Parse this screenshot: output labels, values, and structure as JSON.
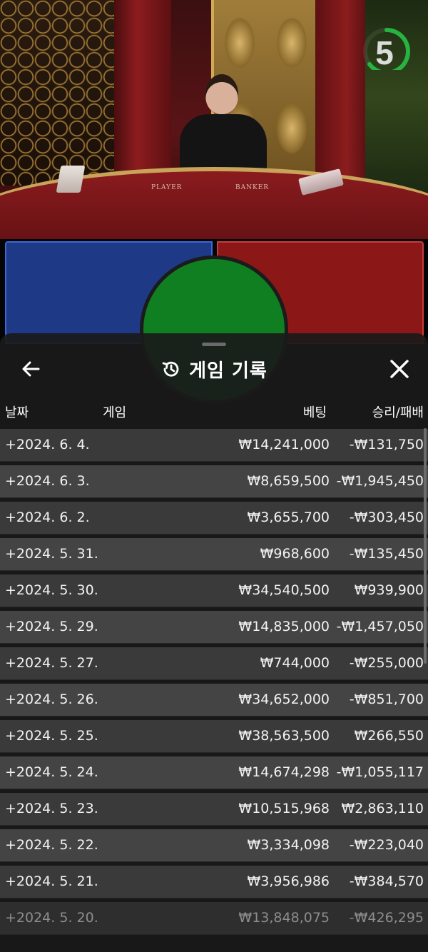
{
  "video": {
    "countdown": "5",
    "table_labels": {
      "player": "PLAYER",
      "banker": "BANKER"
    }
  },
  "sheet": {
    "title": "게임 기록",
    "columns": {
      "date": "날짜",
      "game": "게임",
      "bet": "베팅",
      "result": "승리/패배"
    },
    "rows": [
      {
        "date": "+2024. 6. 4.",
        "bet": "₩14,241,000",
        "result": "-₩131,750"
      },
      {
        "date": "+2024. 6. 3.",
        "bet": "₩8,659,500",
        "result": "-₩1,945,450"
      },
      {
        "date": "+2024. 6. 2.",
        "bet": "₩3,655,700",
        "result": "-₩303,450"
      },
      {
        "date": "+2024. 5. 31.",
        "bet": "₩968,600",
        "result": "-₩135,450"
      },
      {
        "date": "+2024. 5. 30.",
        "bet": "₩34,540,500",
        "result": "₩939,900"
      },
      {
        "date": "+2024. 5. 29.",
        "bet": "₩14,835,000",
        "result": "-₩1,457,050"
      },
      {
        "date": "+2024. 5. 27.",
        "bet": "₩744,000",
        "result": "-₩255,000"
      },
      {
        "date": "+2024. 5. 26.",
        "bet": "₩34,652,000",
        "result": "-₩851,700"
      },
      {
        "date": "+2024. 5. 25.",
        "bet": "₩38,563,500",
        "result": "₩266,550"
      },
      {
        "date": "+2024. 5. 24.",
        "bet": "₩14,674,298",
        "result": "-₩1,055,117"
      },
      {
        "date": "+2024. 5. 23.",
        "bet": "₩10,515,968",
        "result": "₩2,863,110"
      },
      {
        "date": "+2024. 5. 22.",
        "bet": "₩3,334,098",
        "result": "-₩223,040"
      },
      {
        "date": "+2024. 5. 21.",
        "bet": "₩3,956,986",
        "result": "-₩384,570"
      },
      {
        "date": "+2024. 5. 20.",
        "bet": "₩13,848,075",
        "result": "-₩426,295"
      }
    ],
    "icons": {
      "back": "back-arrow-icon",
      "history": "history-icon",
      "close": "close-icon"
    }
  }
}
